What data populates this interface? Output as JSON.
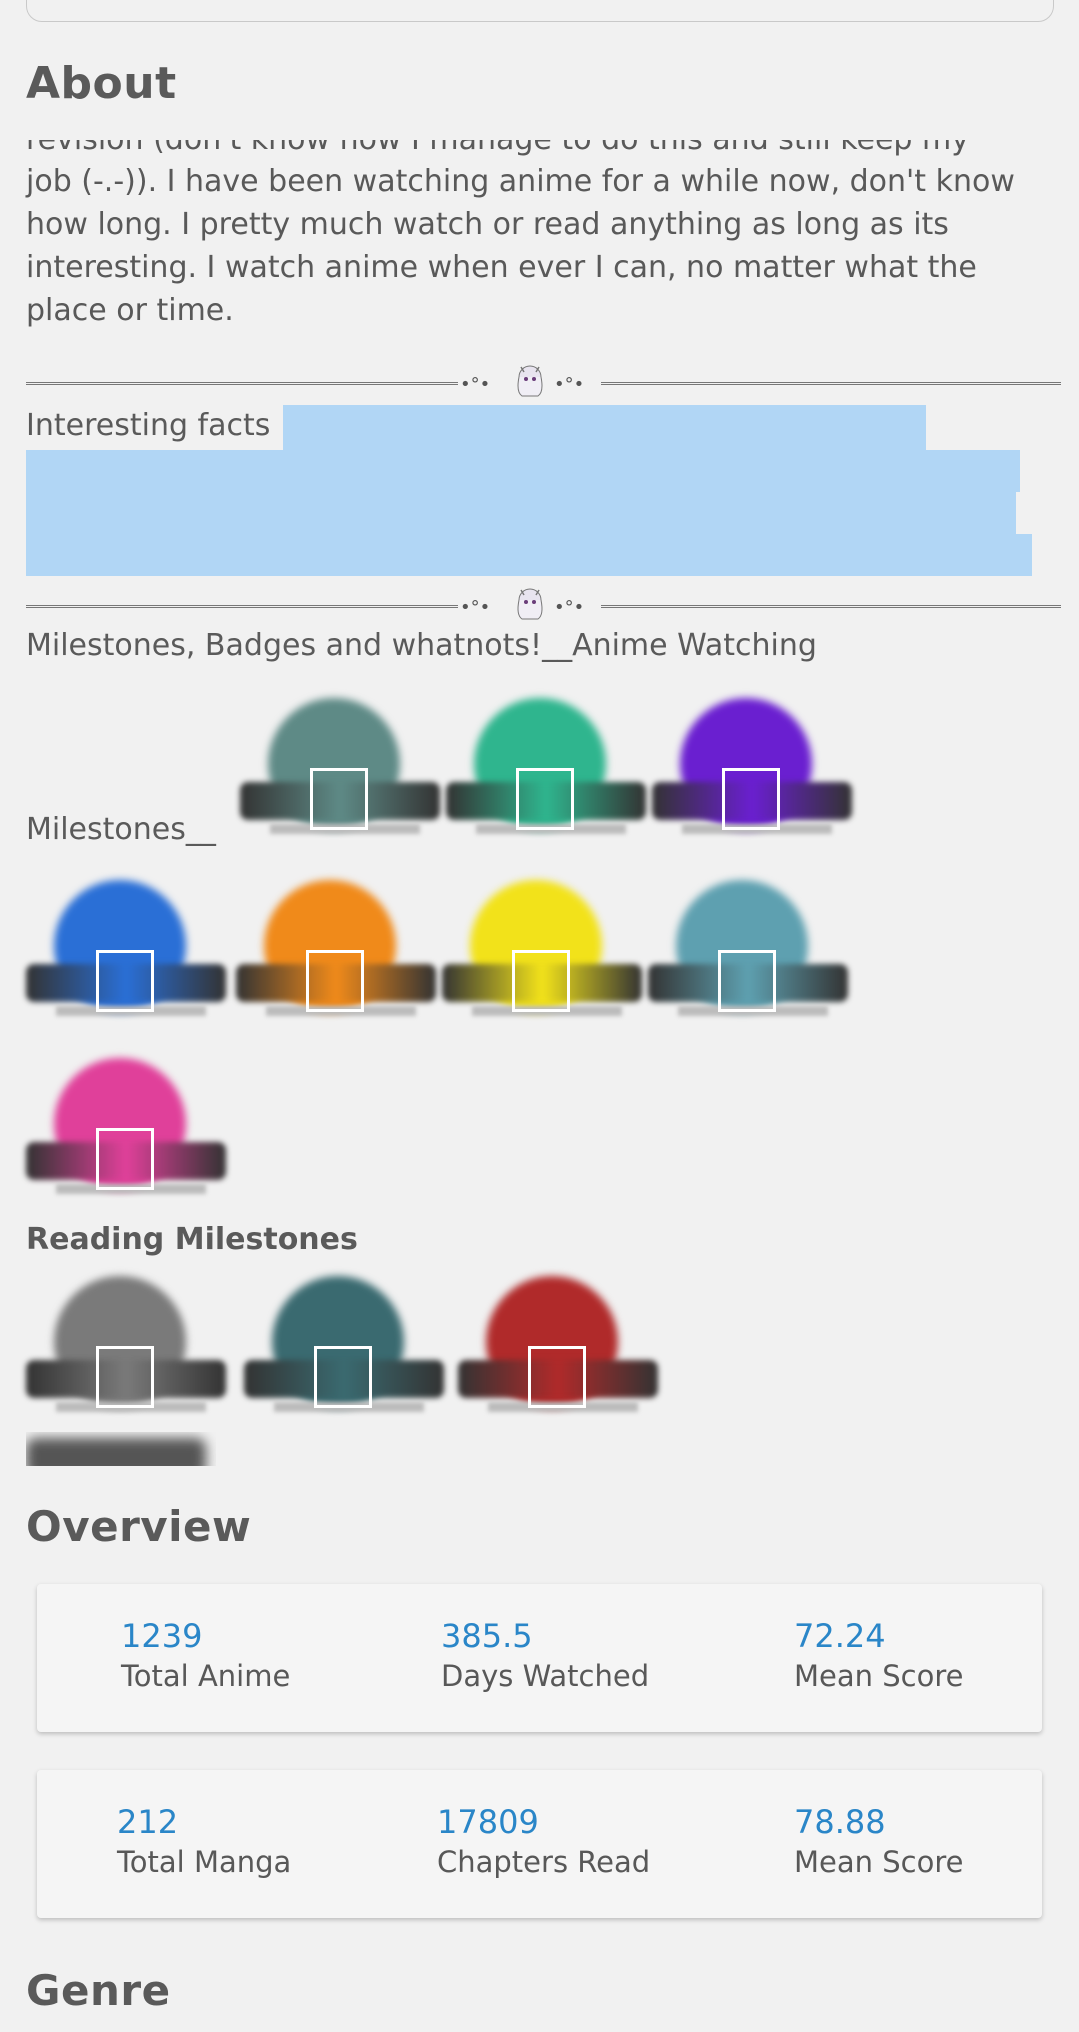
{
  "about": {
    "title": "About",
    "text_clipped": "revision (don't know how I manage to do this and still keep my",
    "text": "job (-.-)). I have been watching anime for a while now, don't know how long. I pretty much watch or read anything as long as its interesting. I watch anime when ever I can, no matter what the place or time.",
    "divider_ornament": "•°• •°•",
    "interesting_facts": "Interesting facts",
    "milestones_heading": "Milestones, Badges and whatnots!__Anime Watching",
    "milestones_label": "Milestones__",
    "reading_label": "Reading Milestones"
  },
  "badge_colors": {
    "anime": [
      "#5e8a86",
      "#2fb58e",
      "#6a1fd0",
      "#2a6fd6",
      "#f08a1a",
      "#f2e21a",
      "#5ea0b0",
      "#e0409a"
    ],
    "manga": [
      "#7a7a7a",
      "#3a6a70",
      "#b02a2a"
    ]
  },
  "overview": {
    "title": "Overview",
    "anime": [
      {
        "value": "1239",
        "label": "Total Anime"
      },
      {
        "value": "385.5",
        "label": "Days Watched"
      },
      {
        "value": "72.24",
        "label": "Mean Score"
      }
    ],
    "manga": [
      {
        "value": "212",
        "label": "Total Manga"
      },
      {
        "value": "17809",
        "label": "Chapters Read"
      },
      {
        "value": "78.88",
        "label": "Mean Score"
      }
    ]
  },
  "genre": {
    "title": "Genre"
  },
  "accent_color": "#2a86c8",
  "highlight_color": "#b1d6f5"
}
